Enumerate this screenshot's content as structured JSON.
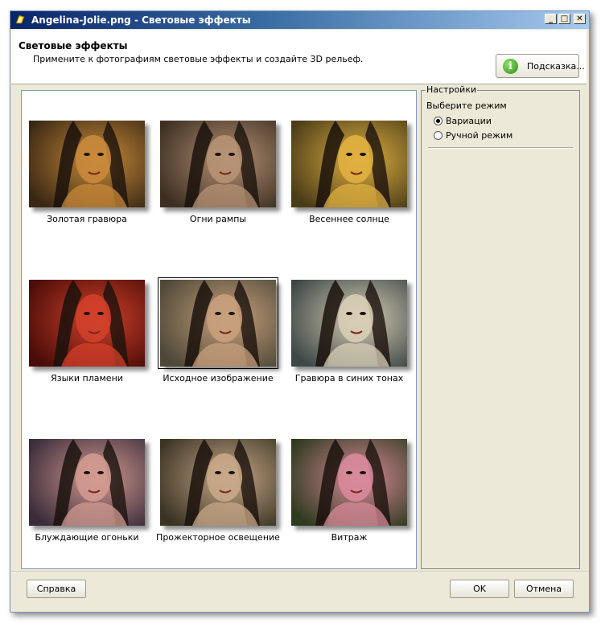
{
  "window": {
    "title": "Angelina-Jolie.png - Световые эффекты",
    "min_label": "_",
    "max_label": "□",
    "close_label": "✕"
  },
  "header": {
    "title": "Световые эффекты",
    "description": "Примените к фотографиям световые эффекты и создайте 3D рельеф.",
    "hint_button": "Подсказка...",
    "hint_icon_glyph": "i"
  },
  "effects": [
    {
      "label": "Золотая гравюра",
      "tone": "#c98a3a",
      "bg": "#3a2814"
    },
    {
      "label": "Огни рампы",
      "tone": "#b79274",
      "bg": "#3c2f22"
    },
    {
      "label": "Весеннее солнце",
      "tone": "#e0b040",
      "bg": "#4a3c18"
    },
    {
      "label": "Языки пламени",
      "tone": "#d2402a",
      "bg": "#4a0d08"
    },
    {
      "label": "Исходное изображение",
      "tone": "#c9a07c",
      "bg": "#4d4838"
    },
    {
      "label": "Гравюра в синих тонах",
      "tone": "#d8cdb5",
      "bg": "#3d4846"
    },
    {
      "label": "Блуждающие огоньки",
      "tone": "#d29a90",
      "bg": "#3b2c3a"
    },
    {
      "label": "Прожекторное освещение",
      "tone": "#c8a888",
      "bg": "#3b3424"
    },
    {
      "label": "Витраж",
      "tone": "#d88a9a",
      "bg": "#2f3a1e"
    }
  ],
  "selected_index": 4,
  "settings": {
    "legend": "Настройки",
    "prompt": "Выберите режим",
    "options": [
      "Вариации",
      "Ручной режим"
    ],
    "selected_option": 0
  },
  "footer": {
    "help": "Справка",
    "ok": "OK",
    "cancel": "Отмена"
  }
}
